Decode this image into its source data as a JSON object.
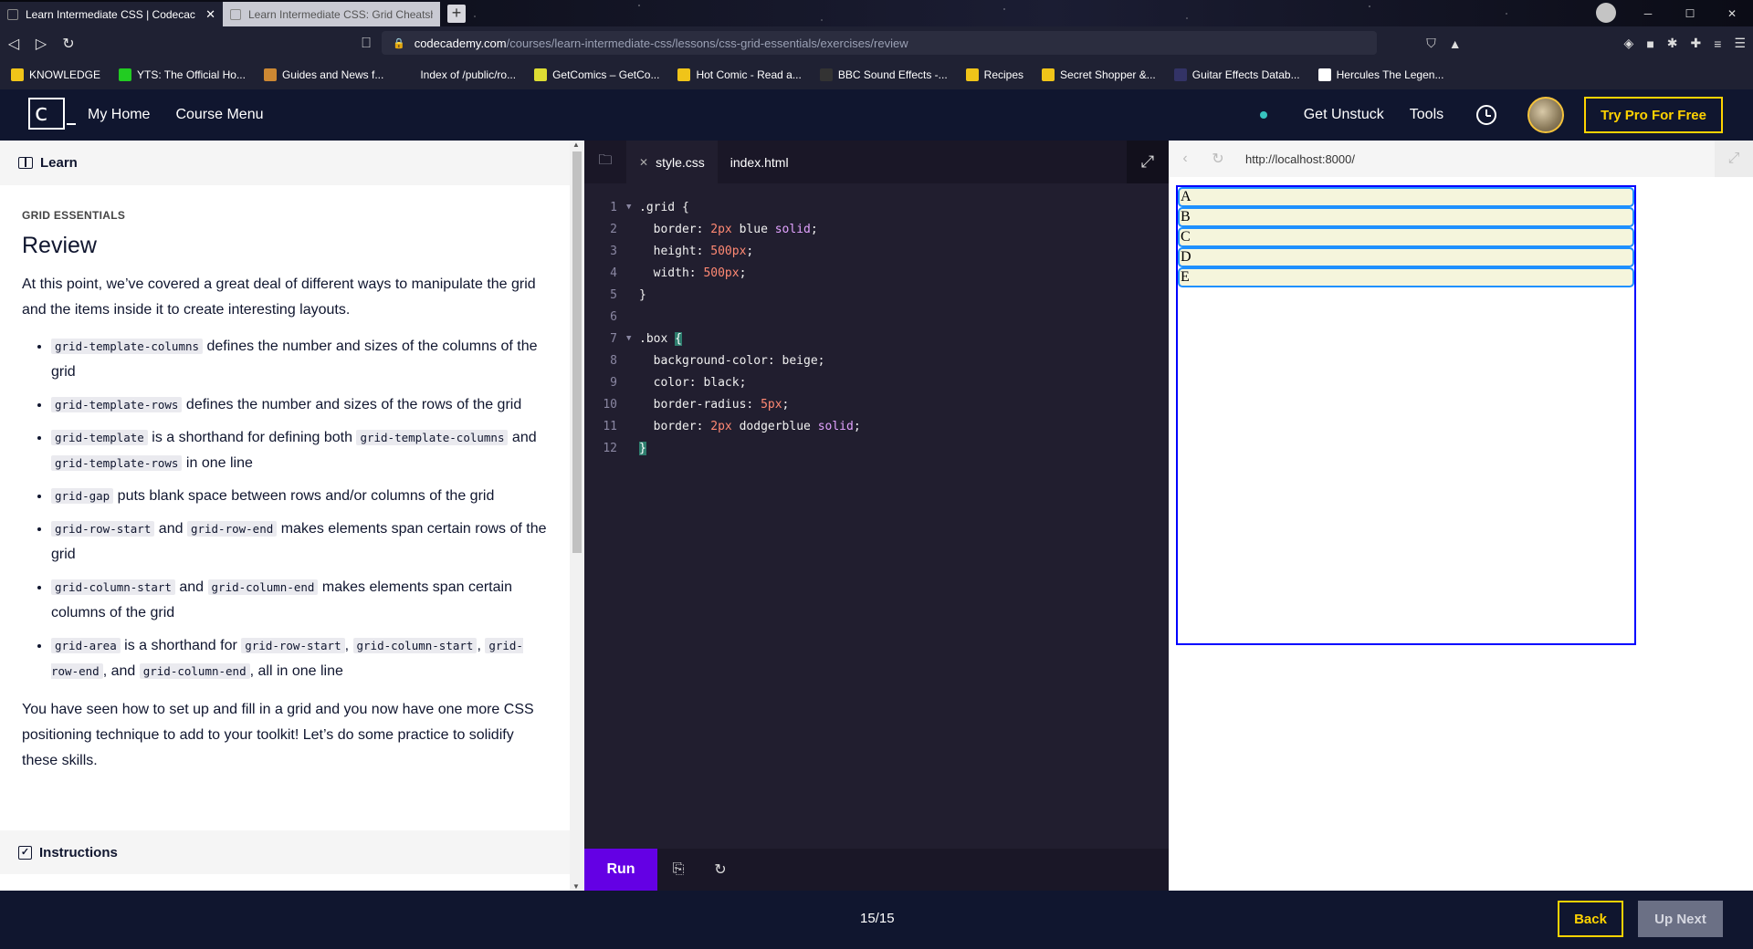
{
  "browser": {
    "tabs": [
      {
        "title": "Learn Intermediate CSS | Codecac",
        "close": "✕"
      },
      {
        "title": "Learn Intermediate CSS: Grid Cheatsh",
        "close": ""
      }
    ],
    "new_tab": "+",
    "url_host": "codecademy.com",
    "url_path": "/courses/learn-intermediate-css/lessons/css-grid-essentials/exercises/review",
    "bookmarks": [
      "KNOWLEDGE",
      "YTS: The Official Ho...",
      "Guides and News f...",
      "Index of /public/ro...",
      "GetComics – GetCo...",
      "Hot Comic - Read a...",
      "BBC Sound Effects -...",
      "Recipes",
      "Secret Shopper &...",
      "Guitar Effects Datab...",
      "Hercules The Legen..."
    ]
  },
  "header": {
    "logo": "c",
    "nav": [
      "My Home",
      "Course Menu"
    ],
    "get_unstuck": "Get Unstuck",
    "tools": "Tools",
    "pro_button": "Try Pro For Free"
  },
  "learn": {
    "tab_label": "Learn",
    "eyebrow": "GRID ESSENTIALS",
    "title": "Review",
    "intro": "At this point, we’ve covered a great deal of different ways to manipulate the grid and the items inside it to create interesting layouts.",
    "points": [
      {
        "parts": [
          {
            "code": "grid-template-columns"
          },
          {
            "text": " defines the number and sizes of the columns of the grid"
          }
        ]
      },
      {
        "parts": [
          {
            "code": "grid-template-rows"
          },
          {
            "text": " defines the number and sizes of the rows of the grid"
          }
        ]
      },
      {
        "parts": [
          {
            "code": "grid-template"
          },
          {
            "text": " is a shorthand for defining both "
          },
          {
            "code": "grid-template-columns"
          },
          {
            "text": " and "
          },
          {
            "code": "grid-template-rows"
          },
          {
            "text": " in one line"
          }
        ]
      },
      {
        "parts": [
          {
            "code": "grid-gap"
          },
          {
            "text": " puts blank space between rows and/or columns of the grid"
          }
        ]
      },
      {
        "parts": [
          {
            "code": "grid-row-start"
          },
          {
            "text": " and "
          },
          {
            "code": "grid-row-end"
          },
          {
            "text": " makes elements span certain rows of the grid"
          }
        ]
      },
      {
        "parts": [
          {
            "code": "grid-column-start"
          },
          {
            "text": " and "
          },
          {
            "code": "grid-column-end"
          },
          {
            "text": " makes elements span certain columns of the grid"
          }
        ]
      },
      {
        "parts": [
          {
            "code": "grid-area"
          },
          {
            "text": " is a shorthand for "
          },
          {
            "code": "grid-row-start"
          },
          {
            "text": ", "
          },
          {
            "code": "grid-column-start"
          },
          {
            "text": ", "
          },
          {
            "code": "grid-row-end"
          },
          {
            "text": ", and "
          },
          {
            "code": "grid-column-end"
          },
          {
            "text": ", all in one line"
          }
        ]
      }
    ],
    "outro": "You have seen how to set up and fill in a grid and you now have one more CSS positioning technique to add to your toolkit! Let’s do some practice to solidify these skills.",
    "instructions_label": "Instructions"
  },
  "editor": {
    "tabs": [
      "style.css",
      "index.html"
    ],
    "tab_close": "✕",
    "lines": [
      {
        "n": "1",
        "fold": "▼",
        "tokens": [
          {
            "c": "sel",
            "t": ".grid"
          },
          {
            "c": "brace",
            "t": " {"
          }
        ]
      },
      {
        "n": "2",
        "fold": "",
        "tokens": [
          {
            "c": "prop",
            "t": "  border: "
          },
          {
            "c": "num",
            "t": "2px"
          },
          {
            "c": "prop",
            "t": " blue "
          },
          {
            "c": "kw",
            "t": "solid"
          },
          {
            "c": "prop",
            "t": ";"
          }
        ]
      },
      {
        "n": "3",
        "fold": "",
        "tokens": [
          {
            "c": "prop",
            "t": "  height: "
          },
          {
            "c": "num",
            "t": "500px"
          },
          {
            "c": "prop",
            "t": ";"
          }
        ]
      },
      {
        "n": "4",
        "fold": "",
        "tokens": [
          {
            "c": "prop",
            "t": "  width: "
          },
          {
            "c": "num",
            "t": "500px"
          },
          {
            "c": "prop",
            "t": ";"
          }
        ]
      },
      {
        "n": "5",
        "fold": "",
        "tokens": [
          {
            "c": "brace",
            "t": "}"
          }
        ]
      },
      {
        "n": "6",
        "fold": "",
        "tokens": []
      },
      {
        "n": "7",
        "fold": "▼",
        "tokens": [
          {
            "c": "sel",
            "t": ".box "
          },
          {
            "c": "hl",
            "t": "{"
          }
        ]
      },
      {
        "n": "8",
        "fold": "",
        "tokens": [
          {
            "c": "prop",
            "t": "  background-color: beige;"
          }
        ]
      },
      {
        "n": "9",
        "fold": "",
        "tokens": [
          {
            "c": "prop",
            "t": "  color: black;"
          }
        ]
      },
      {
        "n": "10",
        "fold": "",
        "tokens": [
          {
            "c": "prop",
            "t": "  border-radius: "
          },
          {
            "c": "num",
            "t": "5px"
          },
          {
            "c": "prop",
            "t": ";"
          }
        ]
      },
      {
        "n": "11",
        "fold": "",
        "tokens": [
          {
            "c": "prop",
            "t": "  border: "
          },
          {
            "c": "num",
            "t": "2px"
          },
          {
            "c": "prop",
            "t": " dodgerblue "
          },
          {
            "c": "kw",
            "t": "solid"
          },
          {
            "c": "prop",
            "t": ";"
          }
        ]
      },
      {
        "n": "12",
        "fold": "",
        "tokens": [
          {
            "c": "hl",
            "t": "}"
          }
        ]
      }
    ],
    "run_label": "Run"
  },
  "preview": {
    "url": "http://localhost:8000/",
    "boxes": [
      "A",
      "B",
      "C",
      "D",
      "E"
    ]
  },
  "footer": {
    "progress": "15/15",
    "back": "Back",
    "next": "Up Next"
  },
  "colors": {
    "brand_dark": "#10162f",
    "accent_yellow": "#ffd300",
    "run_purple": "#6400e4"
  }
}
